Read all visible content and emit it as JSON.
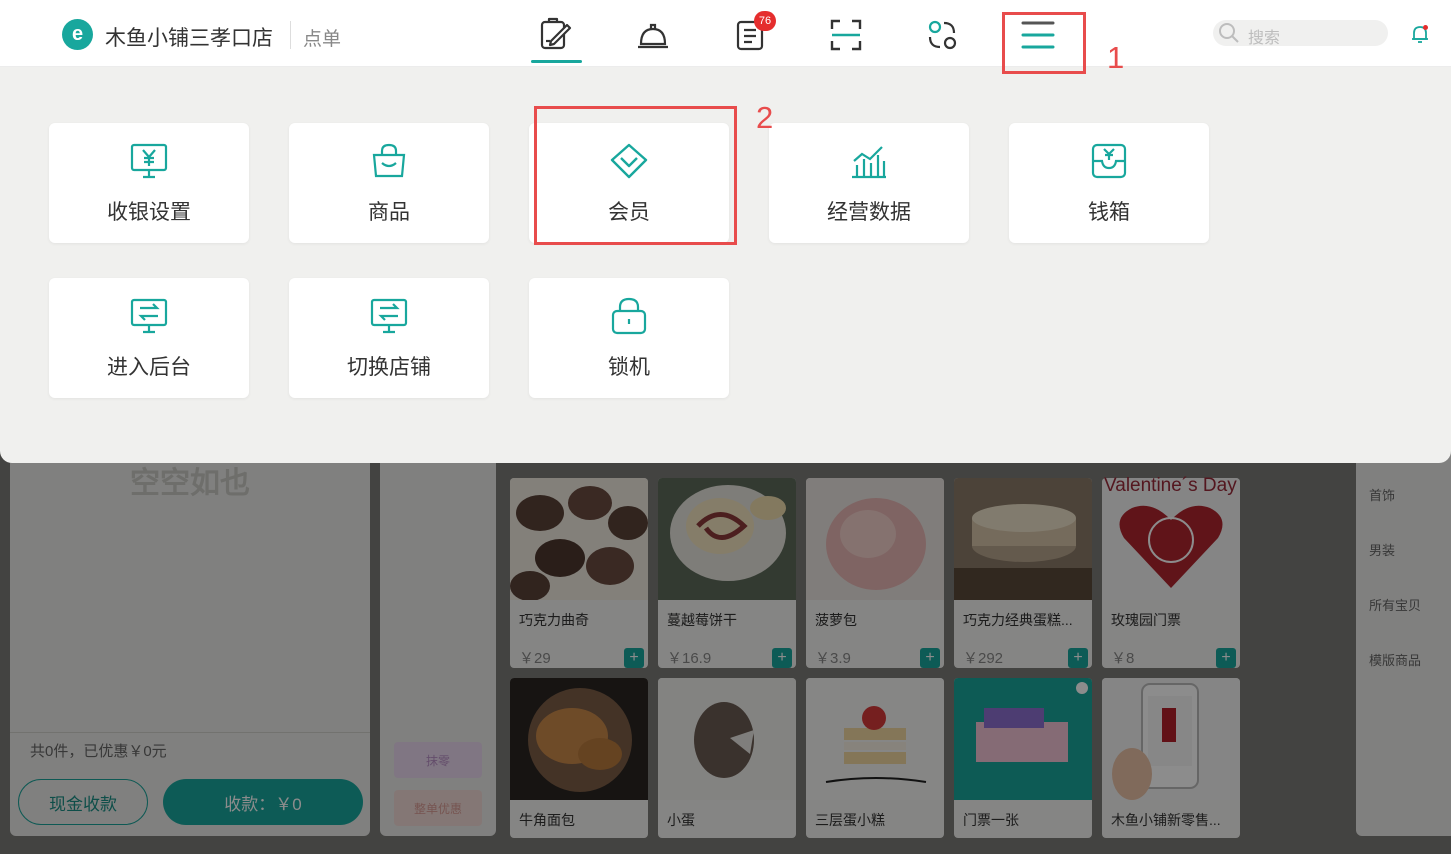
{
  "header": {
    "logo_letter": "e",
    "shop_name": "木鱼小铺三孝口店",
    "mode": "点单",
    "nav_icons": [
      "order-icon",
      "service-bell-icon",
      "list-icon",
      "scan-icon",
      "exchange-icon",
      "menu-icon"
    ],
    "badge_count": "76",
    "search_placeholder": "搜索"
  },
  "menu": {
    "tiles": [
      {
        "label": "收银设置",
        "icon": "cashier-monitor-icon"
      },
      {
        "label": "商品",
        "icon": "shopping-bag-icon"
      },
      {
        "label": "会员",
        "icon": "diamond-icon"
      },
      {
        "label": "经营数据",
        "icon": "chart-icon"
      },
      {
        "label": "钱箱",
        "icon": "cash-drawer-icon"
      },
      {
        "label": "进入后台",
        "icon": "backend-monitor-icon"
      },
      {
        "label": "切换店铺",
        "icon": "switch-store-icon"
      },
      {
        "label": "锁机",
        "icon": "lock-icon"
      }
    ]
  },
  "annotations": {
    "step1": "1",
    "step2": "2"
  },
  "cart": {
    "empty_text": "空空如也",
    "summary": "共0件，已优惠￥0元",
    "cash_button": "现金收款",
    "pay_button": "收款：￥0"
  },
  "discounts": {
    "round_off": "抹零",
    "order_discount": "整单优惠"
  },
  "products": [
    {
      "name": "巧克力曲奇",
      "price": "￥29"
    },
    {
      "name": "蔓越莓饼干",
      "price": "￥16.9"
    },
    {
      "name": "菠萝包",
      "price": "￥3.9"
    },
    {
      "name": "巧克力经典蛋糕...",
      "price": "￥292"
    },
    {
      "name": "玫瑰园门票",
      "price": "￥8"
    },
    {
      "name": "牛角面包",
      "price": ""
    },
    {
      "name": "小蛋",
      "price": ""
    },
    {
      "name": "三层蛋小糕",
      "price": ""
    },
    {
      "name": "门票一张",
      "price": ""
    },
    {
      "name": "木鱼小铺新零售...",
      "price": ""
    }
  ],
  "valentine_text": "Valentine´s Day",
  "categories": [
    "首饰",
    "男装",
    "所有宝贝",
    "模版商品"
  ],
  "colors": {
    "accent": "#18a79d",
    "annotation": "#e84c4c",
    "badge": "#e52d2d"
  }
}
